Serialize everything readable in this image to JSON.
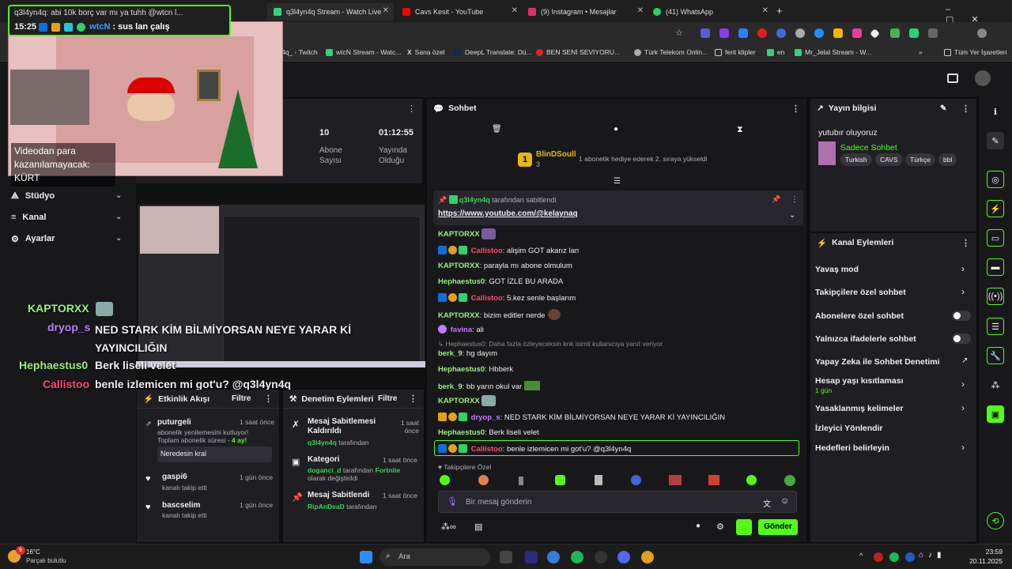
{
  "tabs": [
    {
      "label": "q3l4yn4q Stream - Watch Live",
      "color": "#35d17b"
    },
    {
      "label": "Cavs Kesit - YouTube",
      "color": "#ff0000"
    },
    {
      "label": "(9) Instagram • Mesajlar",
      "color": "#e1306c"
    },
    {
      "label": "(41) WhatsApp",
      "color": "#25d366"
    }
  ],
  "bookmarks": [
    "4q_ - Twitch",
    "wtcN Stream - Watc...",
    "Sana özel",
    "DeepL Translate: Dü...",
    "BEN SENİ SEVİYORU...",
    "Türk Telekom Onlin...",
    "ferit klipler",
    "en",
    "Mr_Jelal Stream - W...",
    "Tüm Yer İşaretleri"
  ],
  "overlay_chat": {
    "top_msg": "q3l4yn4q: abi 10k borç var mı ya tuhh @wtcn l...",
    "time": "15:25",
    "user": "wtcN",
    "text": ": sus lan çalış",
    "video_caption": "Videodan para kazanılamayacak: KÜRT"
  },
  "stream_overlay": [
    {
      "user": "KAPTORXX",
      "text": ""
    },
    {
      "user": "dryop_s",
      "text": "NED STARK KİM BİLMİYORSAN NEYE YARAR Kİ YAYINCILIĞIN"
    },
    {
      "user": "Hephaestus0",
      "text": "Berk liseli velet"
    },
    {
      "user": "Callistoo",
      "text": "benle izlemicen mi got'u? @q3l4yn4q"
    }
  ],
  "left_nav": [
    {
      "label": "Stüdyo"
    },
    {
      "label": "Kanal"
    },
    {
      "label": "Ayarlar"
    }
  ],
  "stats": [
    {
      "value": "10",
      "label": "Abone Sayısı"
    },
    {
      "value": "01:12:55",
      "label": "Yayında Olduğu"
    }
  ],
  "activity": {
    "title": "Etkinlik Akışı",
    "filter": "Filtre",
    "items": [
      {
        "user": "puturgeli",
        "time": "1 saat önce",
        "line1": "abonelik yenilemesini kutluyor!",
        "line2": "Toplam abonelik süresi - ",
        "months": "4 ay!",
        "message": "Neredesin kral"
      },
      {
        "user": "gaspi6",
        "time": "1 gün önce",
        "line1": "kanalı takip etti"
      },
      {
        "user": "bascselim",
        "time": "1 gün önce",
        "line1": "kanalı takip etti"
      }
    ]
  },
  "mod": {
    "title": "Denetim Eylemleri",
    "filter": "Filtre",
    "items": [
      {
        "title": "Mesaj Sabitlemesi Kaldırıldı",
        "time": "1 saat önce",
        "by": "q3l4yn4q",
        "suffix": "tarafından"
      },
      {
        "title": "Kategori",
        "time": "1 saat önce",
        "by": "doganci_d",
        "suffix": "tarafından",
        "cat": "Fortnite",
        "suffix2": "olarak değiştirildi"
      },
      {
        "title": "Mesaj Sabitlendi",
        "time": "1 saat önce",
        "by": "RipAnDeaD",
        "suffix": "tarafından"
      }
    ]
  },
  "chat": {
    "title": "Sohbet",
    "gift_user": "BlinDSoull",
    "gift_count": "3",
    "gift_text": "1 abonelik hediye ederek 2. sıraya yükseldi",
    "pin_by": "q3l4yn4q",
    "pin_suffix": "tarafından sabitlendi",
    "pin_link": "https://www.youtube.com/@kelaynaq",
    "messages": [
      {
        "user": "KAPTORXX",
        "cls": "n-green",
        "text": ""
      },
      {
        "user": "Callistoo",
        "cls": "n-red",
        "text": ": alişim GOT akarız lan",
        "badges": true
      },
      {
        "user": "KAPTORXX",
        "cls": "n-green",
        "text": ": parayla mı abone olmulum"
      },
      {
        "user": "Hephaestus0",
        "cls": "n-green",
        "text": ": GOT İZLE BU ARADA"
      },
      {
        "user": "Callistoo",
        "cls": "n-red",
        "text": ": 5.kez senle başlarım",
        "badges": true
      },
      {
        "user": "KAPTORXX",
        "cls": "n-green",
        "text": ": bizim editler nerde"
      },
      {
        "user": "favina",
        "cls": "n-purple",
        "text": ": ali"
      },
      {
        "user": "berk_9",
        "cls": "n-green",
        "text": ": hg dayım"
      },
      {
        "user": "Hephaestus0",
        "cls": "n-green",
        "text": ": Hbberk"
      },
      {
        "user": "berk_9",
        "cls": "n-green",
        "text": ": bb yarın okul var"
      },
      {
        "user": "KAPTORXX",
        "cls": "n-green",
        "text": ""
      },
      {
        "user": "dryop_s",
        "cls": "n-purple",
        "text": ": NED STARK KİM BİLMİYORSAN NEYE YARAR Kİ YAYINCILIĞIN",
        "badges": true
      },
      {
        "user": "Hephaestus0",
        "cls": "n-green",
        "text": ": Berk liseli velet"
      },
      {
        "user": "Callistoo",
        "cls": "n-red",
        "text": ": benle izlemicen mi got'u? @q3l4yn4q",
        "badges": true
      }
    ],
    "reply_note": "Hephaestus0: Daha fazla özleyeceksin knk isimli kullanıcıya yanıt veriyor",
    "followers_only": "Takipçilere Özel",
    "placeholder": "Bir mesaj gönderin",
    "send": "Gönder"
  },
  "stream_info": {
    "title": "Yayın bilgisi",
    "stream_title": "yutubır oluyoruz",
    "category": "Sadece Sohbet",
    "tags": [
      "Turkish",
      "CAVS",
      "Türkçe",
      "bbl"
    ]
  },
  "channel_actions": {
    "title": "Kanal Eylemleri",
    "items": [
      {
        "label": "Yavaş mod",
        "type": "chev"
      },
      {
        "label": "Takipçilere özel sohbet",
        "type": "chev"
      },
      {
        "label": "Abonelere özel sohbet",
        "type": "toggle"
      },
      {
        "label": "Yalnızca ifadelerle sohbet",
        "type": "toggle"
      },
      {
        "label": "Yapay Zeka ile Sohbet Denetimi",
        "type": "ext"
      },
      {
        "label": "Hesap yaşı kısıtlaması",
        "type": "chev",
        "sub": "1 gün"
      },
      {
        "label": "Yasaklanmış kelimeler",
        "type": "chev"
      },
      {
        "label": "İzleyici Yönlendir",
        "type": "none"
      },
      {
        "label": "Hedefleri belirleyin",
        "type": "chev"
      }
    ]
  },
  "taskbar": {
    "temp": "16°C",
    "weather": "Parçalı bulutlu",
    "search": "Ara",
    "time": "23:59",
    "date": "20.11.2025",
    "notif": "9"
  }
}
